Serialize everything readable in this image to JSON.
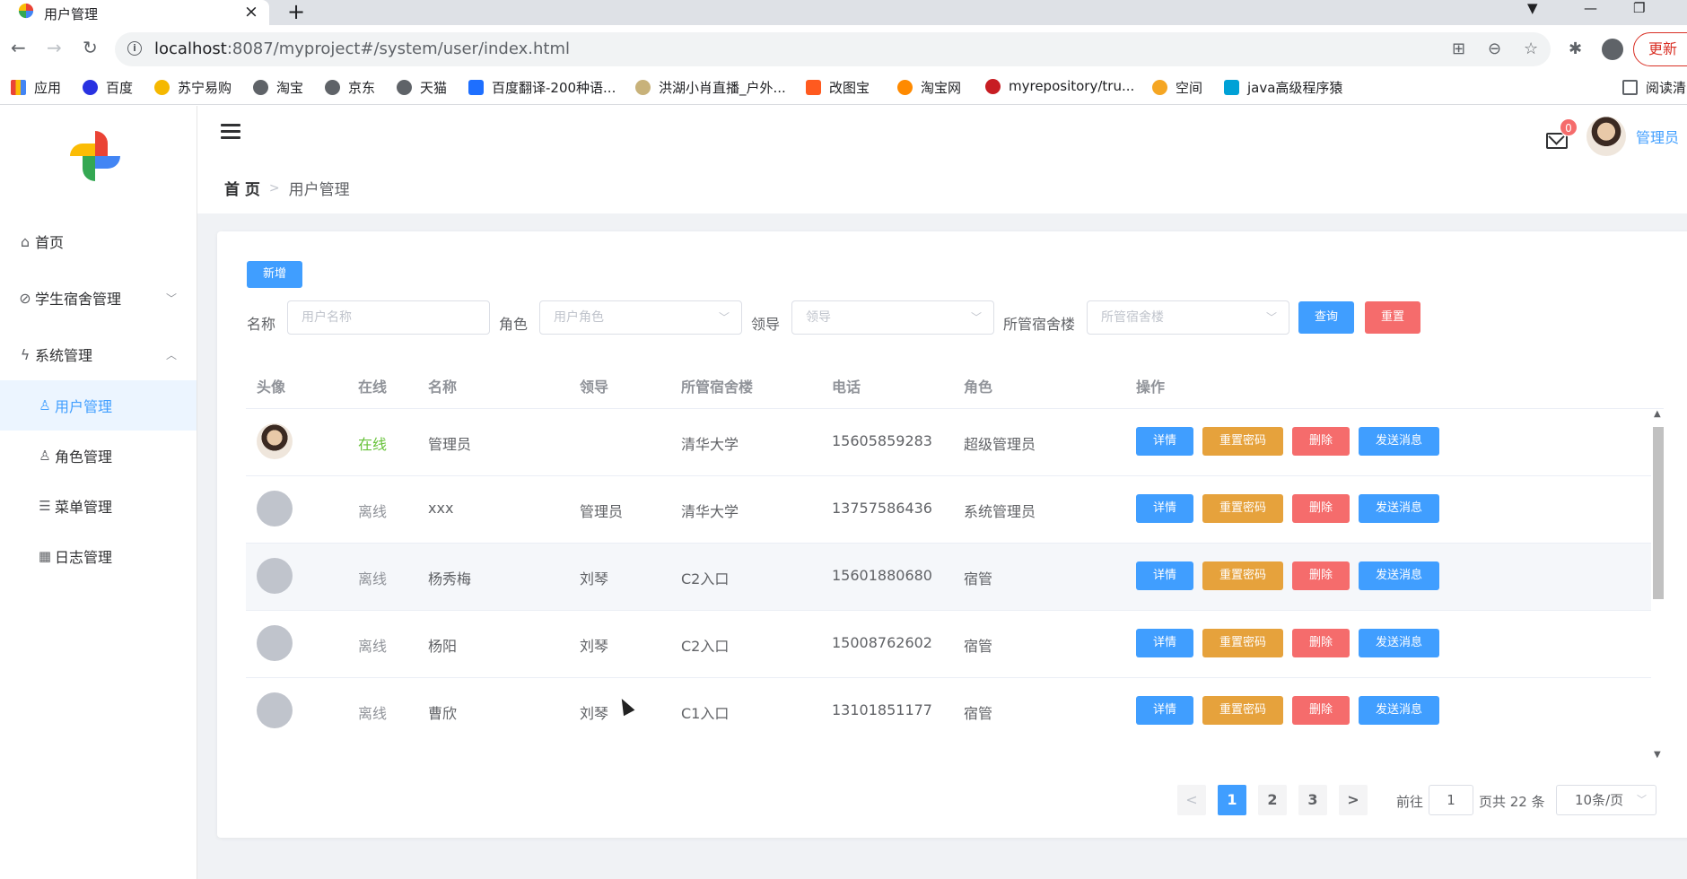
{
  "browser": {
    "tab_title": "用户管理",
    "url_host": "localhost",
    "url_path": ":8087/myproject#/system/user/index.html",
    "update_label": "更新",
    "reading_list": "阅读清",
    "bookmarks": [
      "应用",
      "百度",
      "苏宁易购",
      "淘宝",
      "京东",
      "天猫",
      "百度翻译-200种语...",
      "洪湖小肖直播_户外...",
      "改图宝",
      "淘宝网",
      "myrepository/tru...",
      "空间",
      "java高级程序猿"
    ]
  },
  "sidebar": {
    "home": "首页",
    "dorm": "学生宿舍管理",
    "system": "系统管理",
    "user": "用户管理",
    "role": "角色管理",
    "menu": "菜单管理",
    "log": "日志管理"
  },
  "header": {
    "breadcrumb_home": "首 页",
    "breadcrumb_current": "用户管理",
    "mail_count": "0",
    "user_name": "管理员"
  },
  "toolbar": {
    "add_label": "新增",
    "name_label": "名称",
    "name_placeholder": "用户名称",
    "role_label": "角色",
    "role_placeholder": "用户角色",
    "leader_label": "领导",
    "leader_placeholder": "领导",
    "dorm_label": "所管宿舍楼",
    "dorm_placeholder": "所管宿舍楼",
    "query_label": "查询",
    "reset_label": "重置"
  },
  "table": {
    "headers": [
      "头像",
      "在线",
      "名称",
      "领导",
      "所管宿舍楼",
      "电话",
      "角色",
      "操作"
    ],
    "actions": [
      "详情",
      "重置密码",
      "删除",
      "发送消息"
    ],
    "rows": [
      {
        "online": "在线",
        "name": "管理员",
        "leader": "",
        "dorm": "清华大学",
        "phone": "15605859283",
        "role": "超级管理员"
      },
      {
        "online": "离线",
        "name": "xxx",
        "leader": "管理员",
        "dorm": "清华大学",
        "phone": "13757586436",
        "role": "系统管理员"
      },
      {
        "online": "离线",
        "name": "杨秀梅",
        "leader": "刘琴",
        "dorm": "C2入口",
        "phone": "15601880680",
        "role": "宿管"
      },
      {
        "online": "离线",
        "name": "杨阳",
        "leader": "刘琴",
        "dorm": "C2入口",
        "phone": "15008762602",
        "role": "宿管"
      },
      {
        "online": "离线",
        "name": "曹欣",
        "leader": "刘琴",
        "dorm": "C1入口",
        "phone": "13101851177",
        "role": "宿管"
      }
    ]
  },
  "pagination": {
    "pages": [
      "1",
      "2",
      "3"
    ],
    "goto_label": "前往",
    "goto_value": "1",
    "total_label": "页共 22 条",
    "page_size": "10条/页"
  },
  "colors": {
    "primary": "#409eff",
    "warning": "#e6a23c",
    "danger": "#f56c6c",
    "success": "#67c23a"
  }
}
